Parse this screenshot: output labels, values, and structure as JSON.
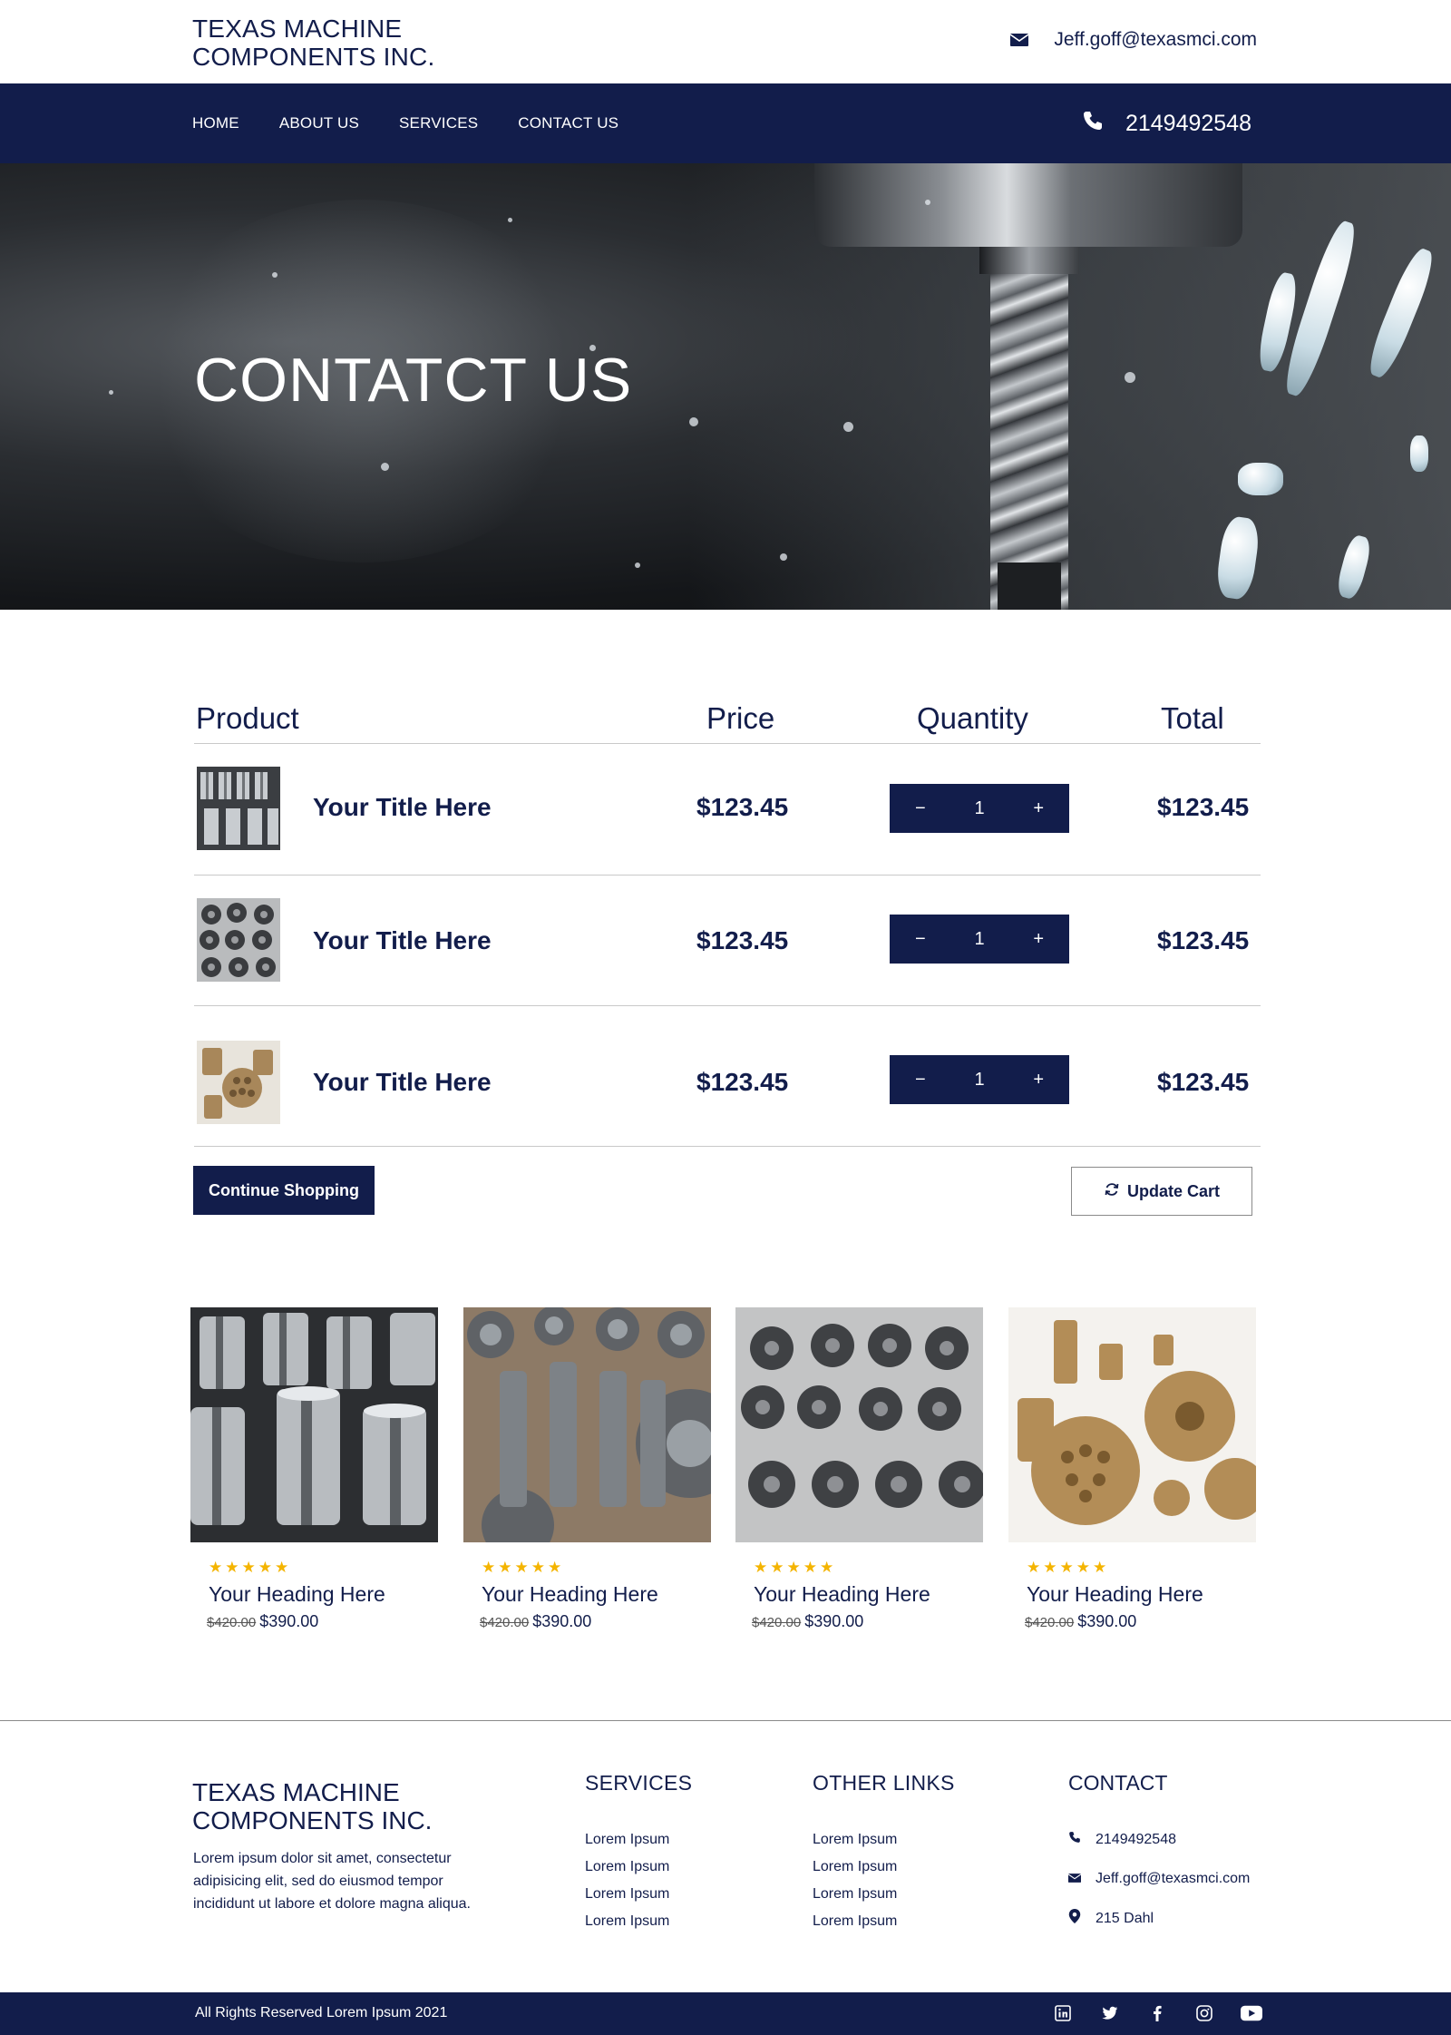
{
  "header": {
    "brand_line1": "TEXAS MACHINE",
    "brand_line2": "COMPONENTS INC.",
    "email": "Jeff.goff@texasmci.com"
  },
  "nav": {
    "items": [
      "HOME",
      "ABOUT US",
      "SERVICES",
      "CONTACT US"
    ],
    "phone": "2149492548"
  },
  "hero": {
    "title": "CONTATCT US"
  },
  "cart": {
    "headers": {
      "product": "Product",
      "price": "Price",
      "quantity": "Quantity",
      "total": "Total"
    },
    "rows": [
      {
        "title": "Your Title Here",
        "price": "$123.45",
        "qty": "1",
        "total": "$123.45",
        "thumb": "cylindrical-parts"
      },
      {
        "title": "Your Title Here",
        "price": "$123.45",
        "qty": "1",
        "total": "$123.45",
        "thumb": "gear-parts"
      },
      {
        "title": "Your Title Here",
        "price": "$123.45",
        "qty": "1",
        "total": "$123.45",
        "thumb": "brass-parts"
      }
    ],
    "minus": "−",
    "plus": "+",
    "continue_label": "Continue Shopping",
    "update_label": "Update Cart"
  },
  "products": [
    {
      "heading": "Your Heading Here",
      "old_price": "$420.00",
      "price": "$390.00",
      "rating": 5,
      "stars": "★★★★★",
      "image": "steel-bushings"
    },
    {
      "heading": "Your Heading Here",
      "old_price": "$420.00",
      "price": "$390.00",
      "rating": 5,
      "stars": "★★★★★",
      "image": "steel-shafts-flanges"
    },
    {
      "heading": "Your Heading Here",
      "old_price": "$420.00",
      "price": "$390.00",
      "rating": 5,
      "stars": "★★★★★",
      "image": "steel-gears"
    },
    {
      "heading": "Your Heading Here",
      "old_price": "$420.00",
      "price": "$390.00",
      "rating": 5,
      "stars": "★★★★★",
      "image": "brass-fittings"
    }
  ],
  "footer": {
    "brand_line1": "TEXAS MACHINE",
    "brand_line2": "COMPONENTS INC.",
    "about": "Lorem ipsum dolor sit amet, consectetur adipisicing elit, sed do eiusmod tempor incididunt ut labore et dolore magna aliqua.",
    "services_title": "SERVICES",
    "services": [
      "Lorem Ipsum",
      "Lorem Ipsum",
      "Lorem Ipsum",
      "Lorem Ipsum"
    ],
    "links_title": "OTHER LINKS",
    "links": [
      "Lorem Ipsum",
      "Lorem Ipsum",
      "Lorem Ipsum",
      "Lorem Ipsum"
    ],
    "contact_title": "CONTACT",
    "phone": "2149492548",
    "email": "Jeff.goff@texasmci.com",
    "address": "215 Dahl",
    "copyright": "All Rights Reserved Lorem Ipsum 2021",
    "socials": [
      "linkedin-icon",
      "twitter-icon",
      "facebook-icon",
      "instagram-icon",
      "youtube-icon"
    ]
  },
  "colors": {
    "navy": "#121d4b",
    "star": "#f4b400",
    "white": "#ffffff"
  }
}
